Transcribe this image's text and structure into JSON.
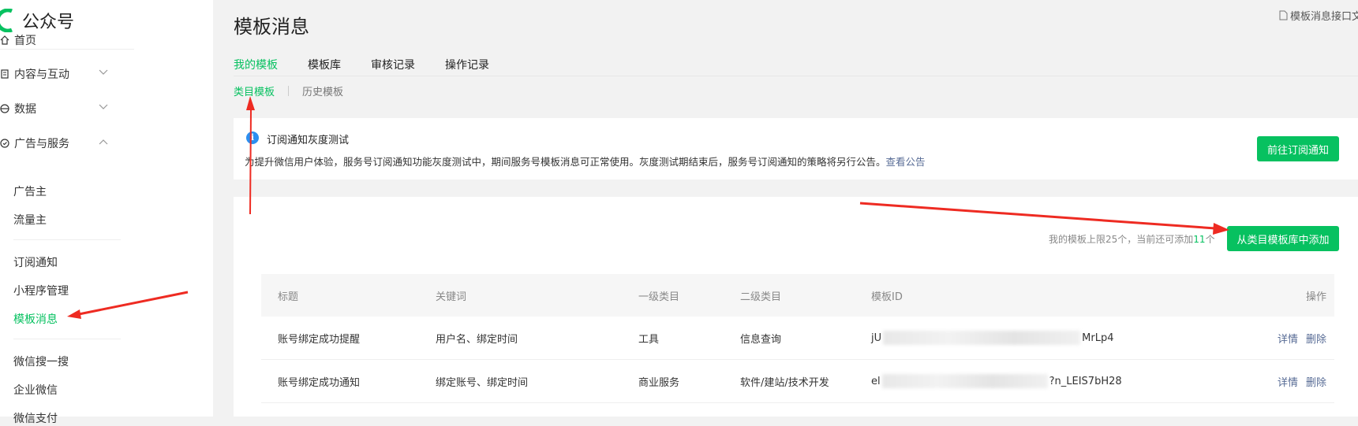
{
  "app": {
    "name": "公众号"
  },
  "sidebar": {
    "items": [
      {
        "label": "首页",
        "icon": "home-icon"
      },
      {
        "label": "内容与互动",
        "icon": "document-icon"
      },
      {
        "label": "数据",
        "icon": "data-icon"
      },
      {
        "label": "广告与服务",
        "icon": "service-icon"
      }
    ],
    "ad_subitems": [
      "广告主",
      "流量主"
    ],
    "service_subitems": [
      "订阅通知",
      "小程序管理",
      "模板消息"
    ],
    "other_subitems": [
      "微信搜一搜",
      "企业微信",
      "微信支付"
    ],
    "active_item": "模板消息"
  },
  "page": {
    "title": "模板消息",
    "doc_link": "模板消息接口文"
  },
  "tabs": [
    "我的模板",
    "模板库",
    "审核记录",
    "操作记录"
  ],
  "subtabs": [
    "类目模板",
    "历史模板"
  ],
  "notice": {
    "title": "订阅通知灰度测试",
    "text": "为提升微信用户体验，服务号订阅通知功能灰度测试中，期间服务号模板消息可正常使用。灰度测试期结束后，服务号订阅通知的策略将另行公告。",
    "link": "查看公告",
    "button": "前往订阅通知"
  },
  "quota": {
    "prefix": "我的模板上限25个，当前还可添加",
    "remaining": "11",
    "suffix": "个"
  },
  "add_button": "从类目模板库中添加",
  "table": {
    "headers": [
      "标题",
      "关键词",
      "一级类目",
      "二级类目",
      "模板ID",
      "操作"
    ],
    "rows": [
      {
        "title": "账号绑定成功提醒",
        "keywords": "用户名、绑定时间",
        "cat1": "工具",
        "cat2": "信息查询",
        "id_start": "jU",
        "id_end": "MrLp4"
      },
      {
        "title": "账号绑定成功通知",
        "keywords": "绑定账号、绑定时间",
        "cat1": "商业服务",
        "cat2": "软件/建站/技术开发",
        "id_start": "el",
        "id_end": "?n_LEIS7bH28"
      }
    ],
    "actions": [
      "详情",
      "删除"
    ]
  },
  "colors": {
    "accent": "#07c160",
    "link": "#576b95",
    "info": "#2b8ff0",
    "annotation": "#ee2b22"
  }
}
